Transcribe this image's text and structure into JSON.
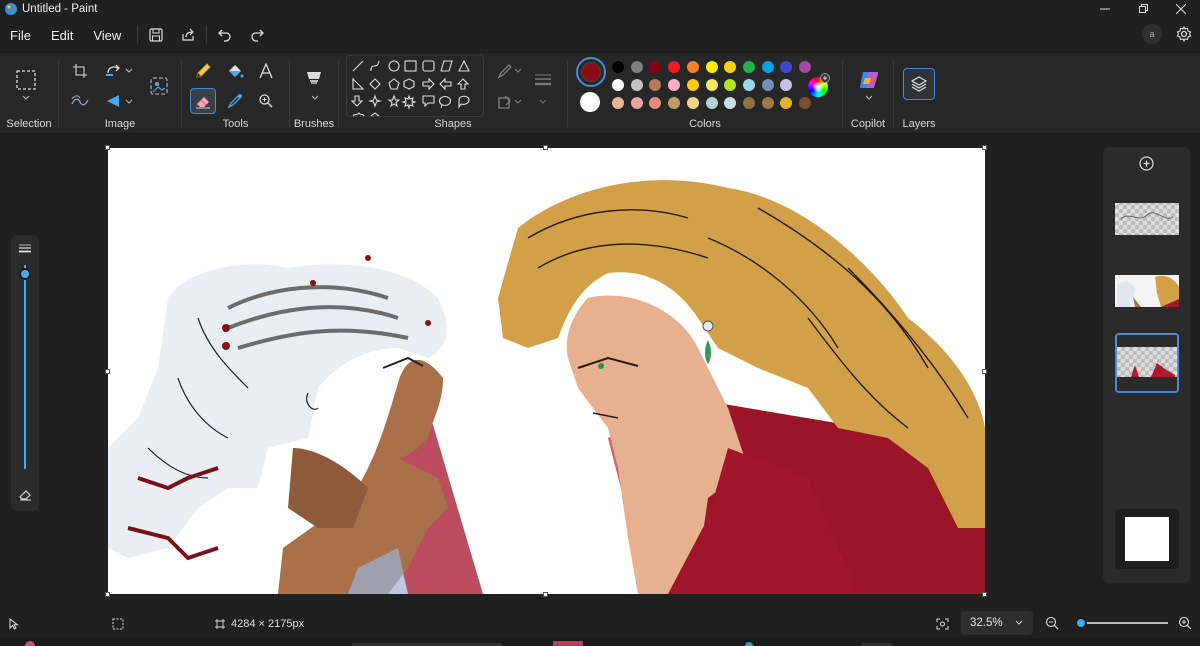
{
  "window": {
    "title": "Untitled - Paint",
    "minimize_icon": "minimize-icon",
    "maximize_icon": "maximize-icon",
    "close_icon": "close-icon"
  },
  "menu": {
    "file": "File",
    "edit": "Edit",
    "view": "View"
  },
  "quick_access": [
    "save-icon",
    "share-icon",
    "undo-icon",
    "redo-icon"
  ],
  "top_right": {
    "account_badge": "a",
    "settings_icon": "gear-icon"
  },
  "ribbon": {
    "selection_label": "Selection",
    "image_label": "Image",
    "tools_label": "Tools",
    "brushes_label": "Brushes",
    "shapes_label": "Shapes",
    "colors_label": "Colors",
    "copilot_label": "Copilot",
    "layers_label": "Layers"
  },
  "colors": {
    "primary": "#8b0e14",
    "secondary": "#ffffff",
    "row1": [
      "#000000",
      "#7f7f7f",
      "#880015",
      "#ed1c24",
      "#ff7f27",
      "#fff200",
      "#fbd10a",
      "#22b14c",
      "#00a2e8",
      "#3f48cc",
      "#a349a4"
    ],
    "row2": [
      "#ffffff",
      "#c3c3c3",
      "#b97a57",
      "#ffaec9",
      "#ffc90e",
      "#fbe75d",
      "#b5e61d",
      "#99d9ea",
      "#7092be",
      "#c8bfe7"
    ],
    "row3": [
      "#e9b596",
      "#e8a7a0",
      "#ea8d81",
      "#c29a67",
      "#efd687",
      "#b4d2d6",
      "#c9dde8",
      "#93703f",
      "#a27a46",
      "#e1b134",
      "#7a4f2b"
    ]
  },
  "status": {
    "canvas_size": "4284 × 2175px",
    "zoom": "32.5%"
  },
  "zoom_slider_fraction": 0.05
}
